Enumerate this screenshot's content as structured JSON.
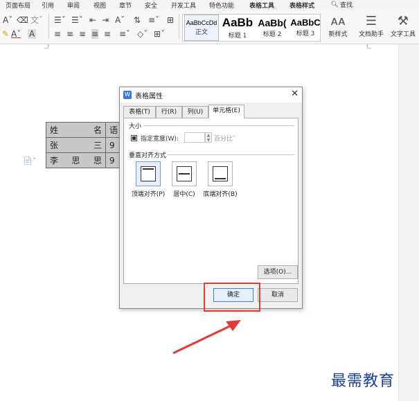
{
  "menu": {
    "items": [
      "页面布局",
      "引用",
      "审阅",
      "视图",
      "章节",
      "安全",
      "开发工具",
      "特色功能",
      "表格工具",
      "表格样式"
    ],
    "search": "查找"
  },
  "ribbon": {
    "styles": [
      {
        "sample": "AaBbCcDd",
        "name": "正文"
      },
      {
        "sample": "AaBb",
        "name": "标题 1"
      },
      {
        "sample": "AaBb(",
        "name": "标题 2"
      },
      {
        "sample": "AaBbC",
        "name": "标题 3"
      }
    ],
    "new_style": "新样式",
    "doc_assistant": "文档助手",
    "text_tools": "文字工具"
  },
  "doc_table": {
    "rows": [
      [
        "姓",
        "名",
        "语"
      ],
      [
        "张",
        "三",
        "9"
      ],
      [
        "李",
        "思",
        "思",
        "9"
      ]
    ]
  },
  "dialog": {
    "title": "表格属性",
    "tabs": [
      "表格(T)",
      "行(R)",
      "列(U)",
      "单元格(E)"
    ],
    "active_tab": "单元格(E)",
    "size_group": "大小",
    "specify_width_label": "指定宽度(W):",
    "specify_width_checked": true,
    "width_value": "",
    "width_unit": "百分比",
    "valign_group": "垂直对齐方式",
    "valign_options": [
      "顶端对齐(P)",
      "居中(C)",
      "底端对齐(B)"
    ],
    "valign_selected": "顶端对齐(P)",
    "options_button": "选项(O)...",
    "ok_button": "确定",
    "cancel_button": "取消"
  },
  "annotations": {
    "highlight_color": "#e53935",
    "watermark": "最需教育"
  }
}
